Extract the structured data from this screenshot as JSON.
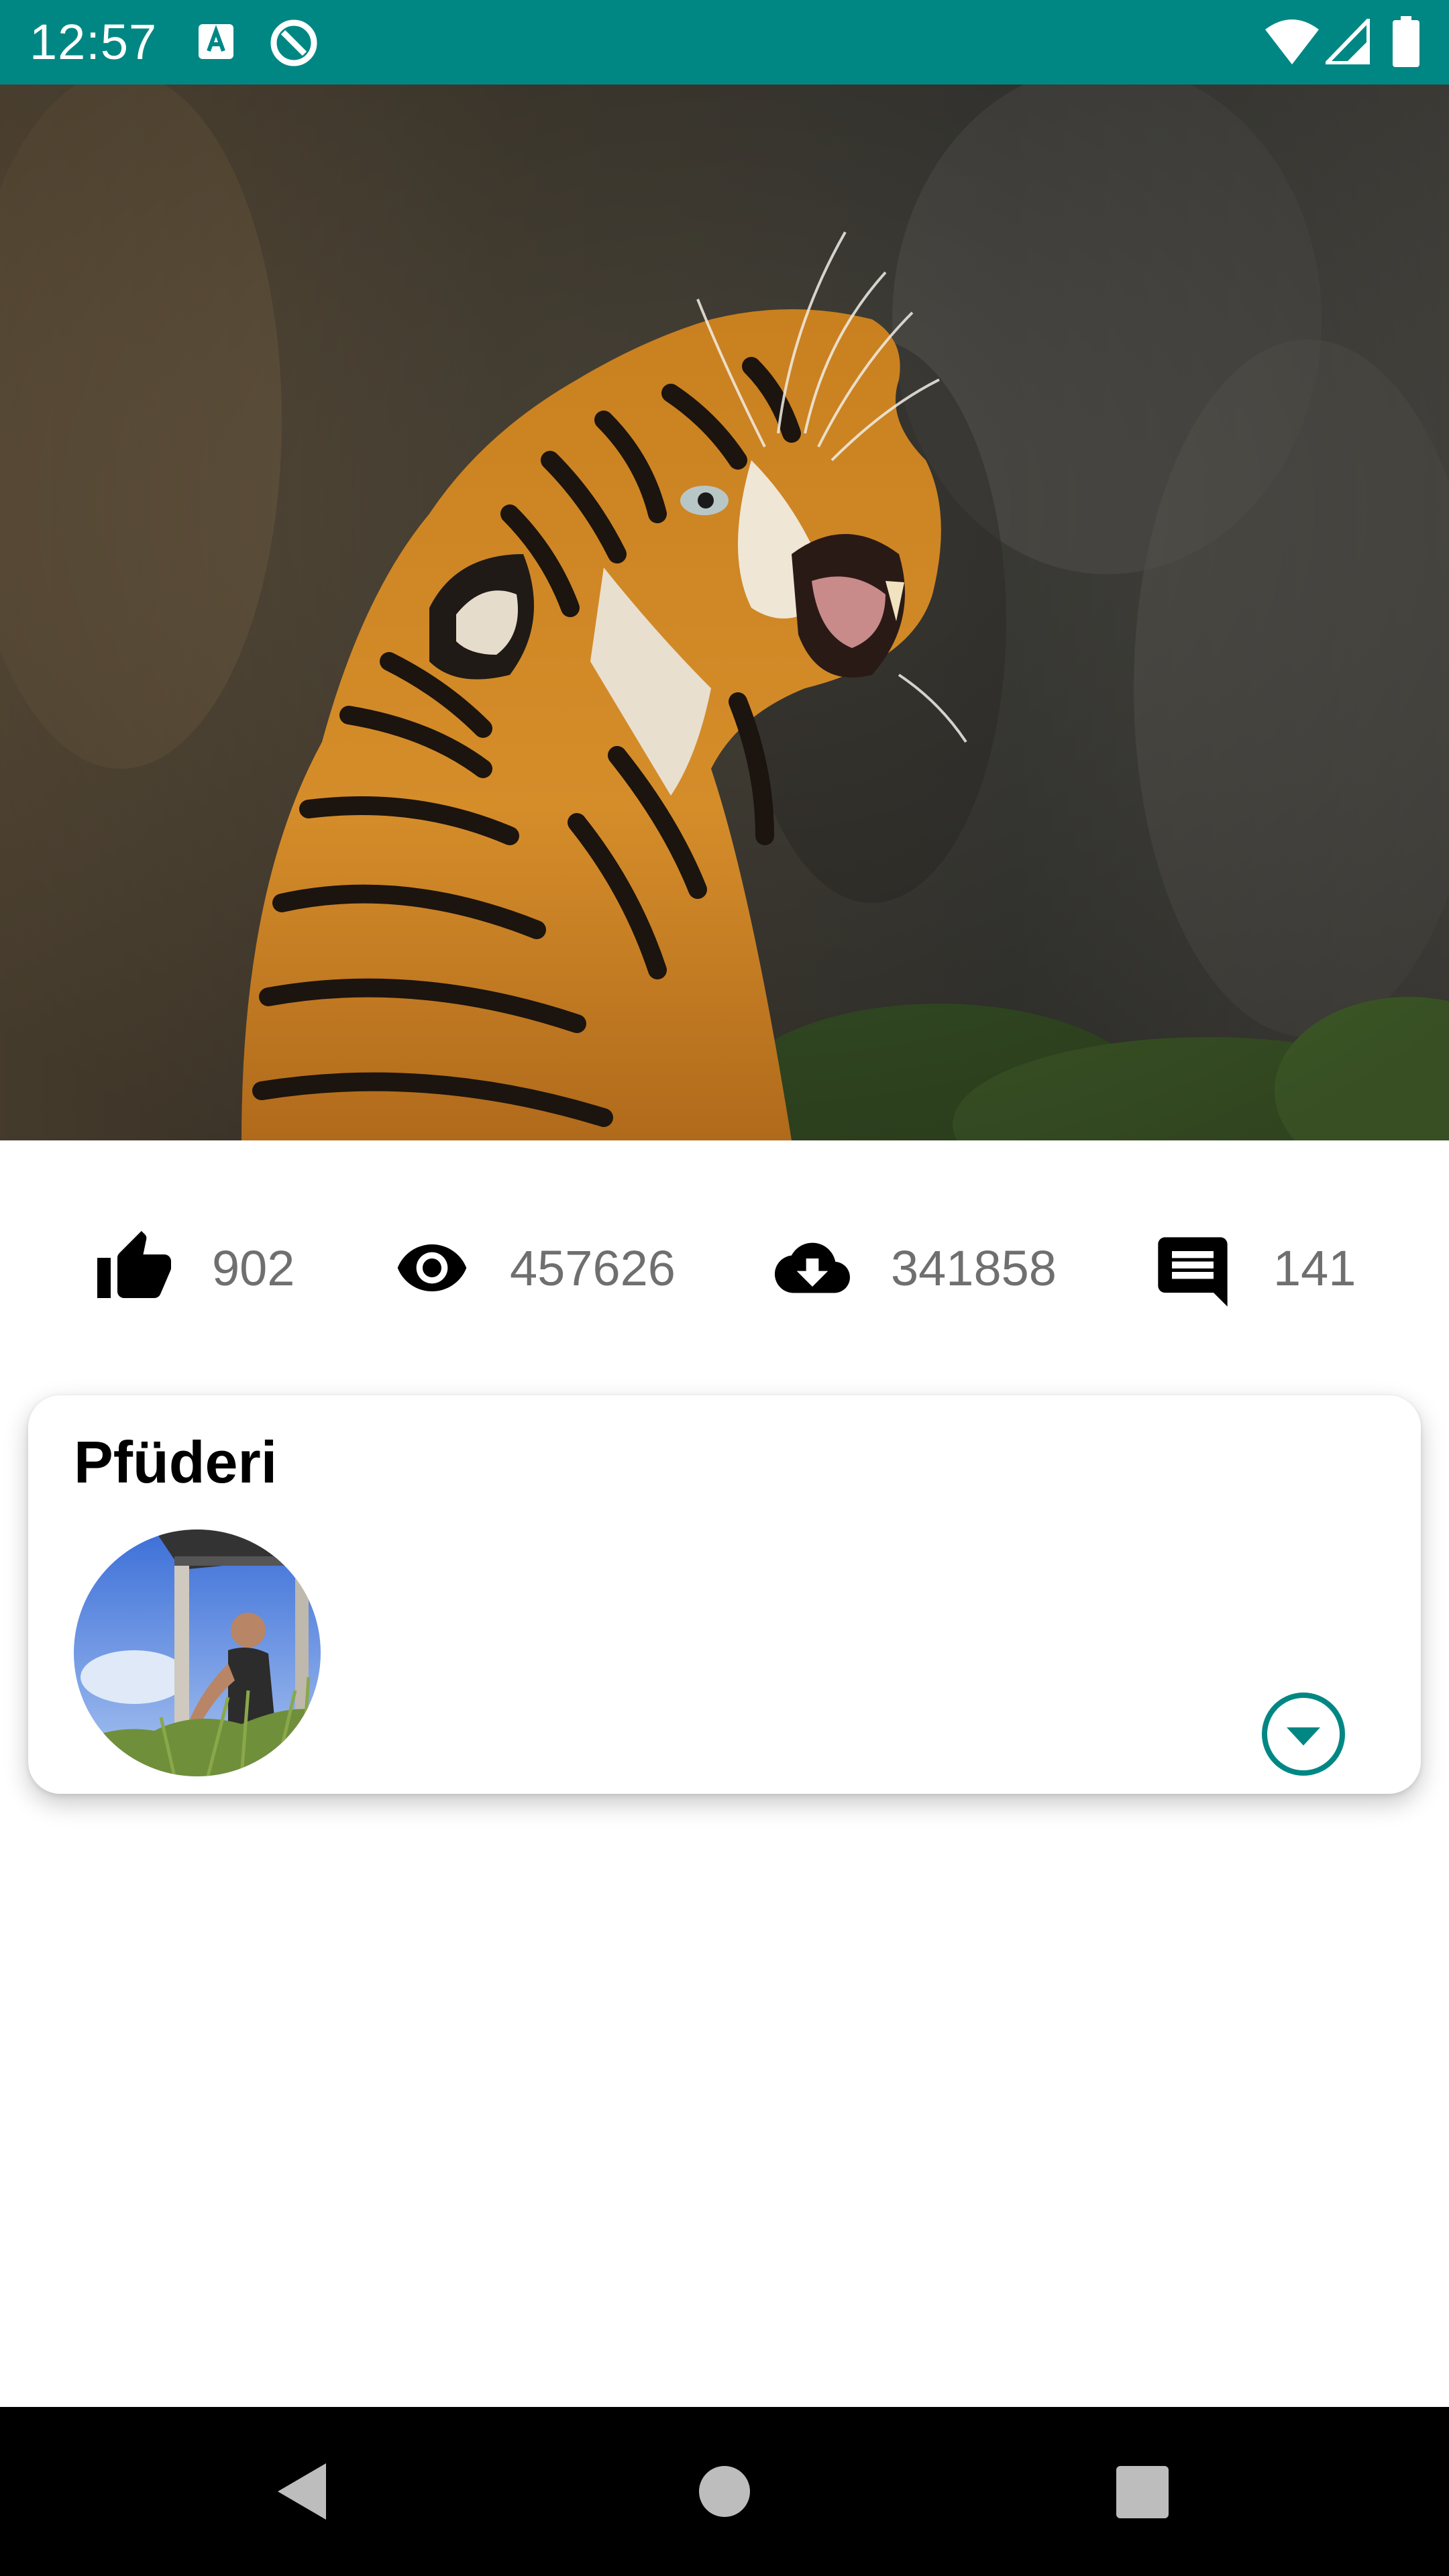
{
  "status_bar": {
    "time": "12:57",
    "icons": [
      "text-a-icon",
      "sync-icon",
      "wifi-icon",
      "signal-icon",
      "battery-icon"
    ],
    "background": "#008784"
  },
  "hero_image": {
    "subject": "tiger-photo"
  },
  "stats": [
    {
      "icon": "thumb-up-icon",
      "value": "902"
    },
    {
      "icon": "eye-icon",
      "value": "457626"
    },
    {
      "icon": "cloud-download-icon",
      "value": "341858"
    },
    {
      "icon": "comment-icon",
      "value": "141"
    }
  ],
  "card": {
    "title": "Pfüderi",
    "accent": "#008784"
  },
  "nav_bar": {
    "buttons": [
      "back-icon",
      "home-icon",
      "recents-icon"
    ]
  }
}
